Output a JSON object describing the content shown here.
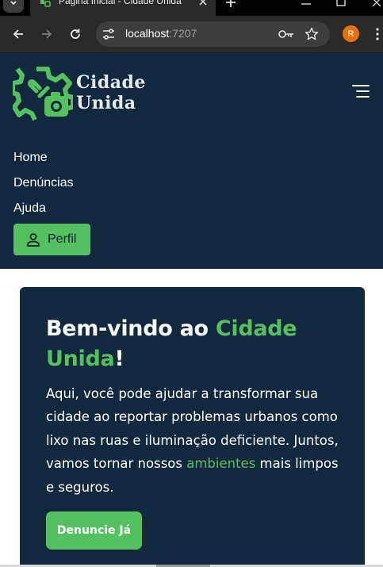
{
  "browser": {
    "tab_title": "Página Inicial - Cidade Unida",
    "url_host": "localhost",
    "url_port": ":7207",
    "profile_initial": "R",
    "icons": [
      "tab-search-icon",
      "favicon",
      "close-icon",
      "new-tab-icon",
      "minimize-icon",
      "maximize-icon",
      "window-close-icon",
      "back-icon",
      "forward-icon",
      "reload-icon",
      "site-info-icon",
      "password-key-icon",
      "bookmark-star-icon",
      "kebab-menu-icon"
    ]
  },
  "header": {
    "brand_line1": "Cidade",
    "brand_line2": "Unida",
    "nav": {
      "home": "Home",
      "denuncias": "Denúncias",
      "ajuda": "Ajuda"
    },
    "profile_button": "Perfil",
    "icons": [
      "logo-icon",
      "hamburger-menu-icon",
      "person-icon"
    ]
  },
  "hero": {
    "title_prefix": "Bem-vindo ao ",
    "title_highlight": "Cidade Unida",
    "title_suffix": "!",
    "body_before": "Aqui, você pode ajudar a transformar sua cidade ao reportar problemas urbanos como lixo nas ruas e iluminação deficiente. Juntos, vamos tornar nossos ",
    "body_highlight": "ambientes",
    "body_after": " mais limpos e seguros.",
    "cta": "Denuncie Já"
  },
  "colors": {
    "brand_green": "#55c060",
    "navy": "#12293d",
    "chrome_dark": "#2a2a2a",
    "profile_orange": "#e8710a"
  }
}
